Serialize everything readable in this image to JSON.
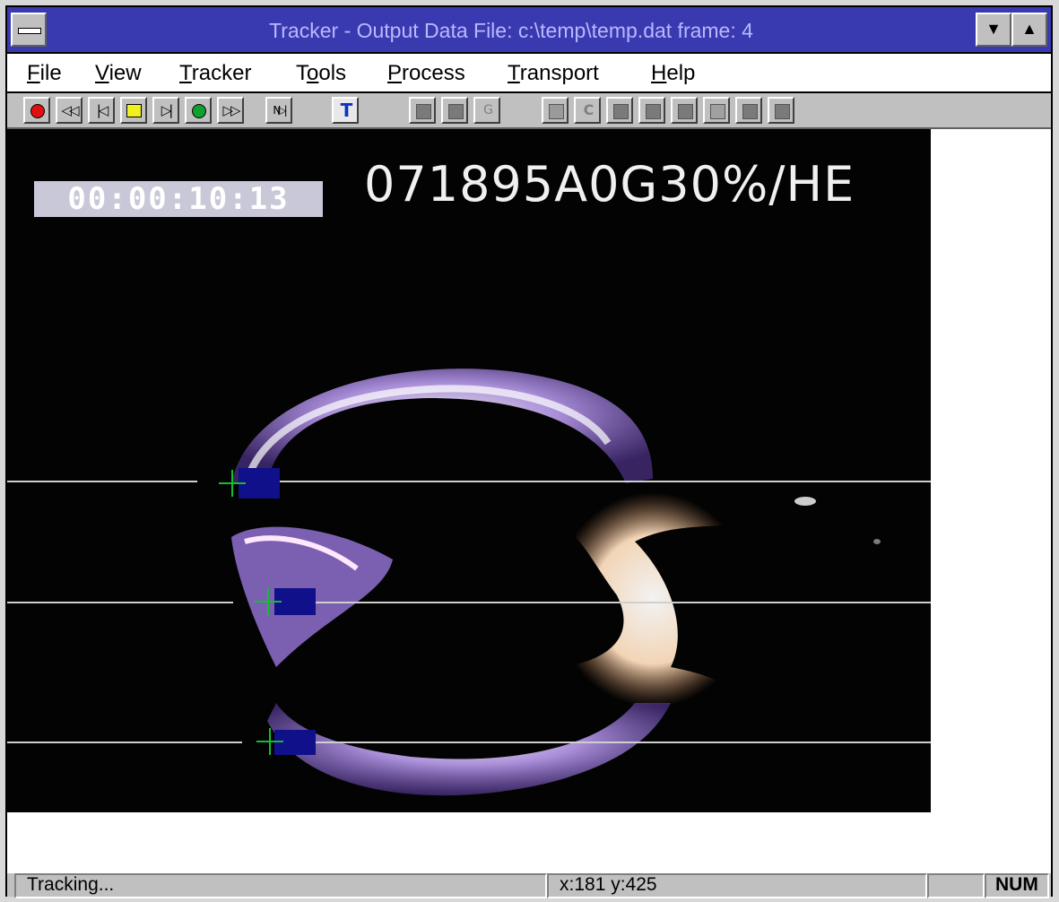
{
  "window": {
    "title": "Tracker - Output Data File: c:\\temp\\temp.dat  frame: 4",
    "minimize_glyph": "▼",
    "maximize_glyph": "▲"
  },
  "menu": {
    "items": [
      {
        "accel": "F",
        "rest": "ile"
      },
      {
        "accel": "V",
        "rest": "iew"
      },
      {
        "accel": "T",
        "rest": "racker"
      },
      {
        "pre": "T",
        "accel": "o",
        "rest": "ols"
      },
      {
        "accel": "P",
        "rest": "rocess"
      },
      {
        "accel": "T",
        "rest": "ransport"
      },
      {
        "accel": "H",
        "rest": "elp"
      }
    ]
  },
  "toolbar": {
    "buttons": [
      {
        "icon": "record-icon",
        "color": "#e01010"
      },
      {
        "icon": "rewind-icon",
        "glyph": "◁◁"
      },
      {
        "icon": "step-back-icon",
        "glyph": "|◁"
      },
      {
        "icon": "stop-icon",
        "color": "#f0f020"
      },
      {
        "icon": "step-forward-icon",
        "glyph": "▷|"
      },
      {
        "icon": "play-icon",
        "color": "#10a030"
      },
      {
        "icon": "fast-forward-icon",
        "glyph": "▷▷"
      },
      {
        "icon": "next-marker-icon",
        "glyph": "N▷|"
      },
      {
        "icon": "text-tool-icon",
        "glyph": "T"
      },
      {
        "icon": "clapper-icon"
      },
      {
        "icon": "clapper-open-icon"
      },
      {
        "icon": "clapper-g-icon",
        "glyph": "G"
      },
      {
        "icon": "camera-icon"
      },
      {
        "icon": "cycle-icon",
        "glyph": "C"
      },
      {
        "icon": "pointer-icon-1"
      },
      {
        "icon": "pointer-icon-2"
      },
      {
        "icon": "pointer-icon-3"
      },
      {
        "icon": "pointer-icon-4"
      },
      {
        "icon": "pin-icon-1"
      },
      {
        "icon": "pin-icon-2"
      }
    ]
  },
  "video": {
    "timecode": "00:00:10:13",
    "overlay_code": "071895A0G30%/HE"
  },
  "status": {
    "message": "Tracking...",
    "coords": "x:181 y:425",
    "num": "NUM"
  }
}
